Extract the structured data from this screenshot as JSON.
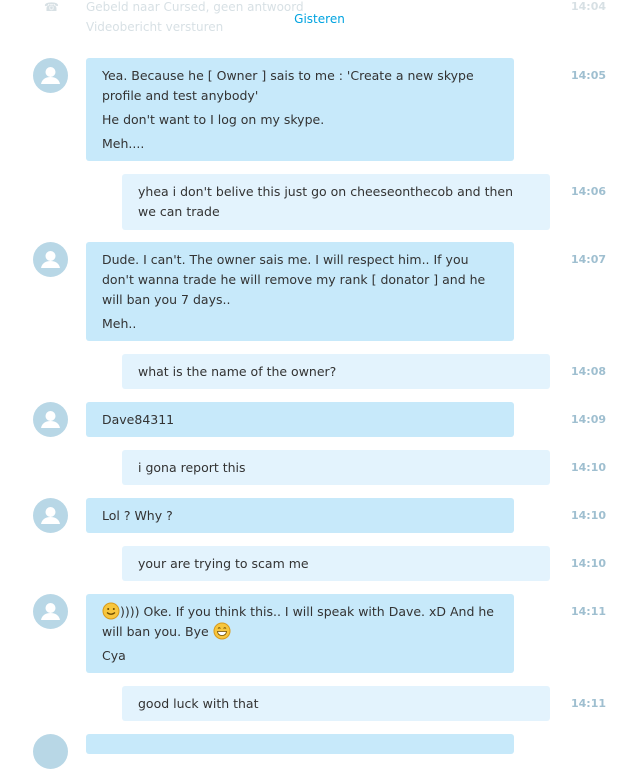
{
  "top_fade": {
    "call_line": "Gebeld naar Cursed, geen antwoord",
    "video_line": "Videobericht versturen",
    "time": "14:04"
  },
  "day_label": "Gisteren",
  "messages": [
    {
      "dir": "in",
      "time": "14:05",
      "lines": [
        "Yea. Because he [ Owner ] sais to me : 'Create a new skype profile and test anybody'",
        "He don't want to I log on my skype.",
        "Meh...."
      ]
    },
    {
      "dir": "out",
      "time": "14:06",
      "lines": [
        "yhea i don't belive this just go on cheeseonthecob and then we can trade"
      ]
    },
    {
      "dir": "in",
      "time": "14:07",
      "lines": [
        "Dude. I can't. The owner sais me. I will respect him.. If you don't wanna trade he will remove my rank [ donator ] and he will ban you 7 days..",
        "Meh.."
      ]
    },
    {
      "dir": "out",
      "time": "14:08",
      "lines": [
        "what is the name of the owner?"
      ]
    },
    {
      "dir": "in",
      "time": "14:09",
      "lines": [
        "Dave84311"
      ]
    },
    {
      "dir": "out",
      "time": "14:10",
      "lines": [
        "i gona report this"
      ]
    },
    {
      "dir": "in",
      "time": "14:10",
      "lines": [
        "Lol ? Why ?"
      ]
    },
    {
      "dir": "out",
      "time": "14:10",
      "lines": [
        "your are trying to scam me"
      ]
    },
    {
      "dir": "in",
      "time": "14:11",
      "emoji_text_a": ")))) Oke. If you think this.. I will speak with Dave. xD And he will ban you. Bye",
      "lines": [
        "Cya"
      ]
    },
    {
      "dir": "out",
      "time": "14:11",
      "lines": [
        "good luck with that"
      ]
    }
  ],
  "icons": {
    "avatar": "default-user-avatar-icon",
    "emoji": "smile-emoji-icon",
    "call": "phone-icon"
  },
  "colors": {
    "incoming_bubble": "#c7e9fa",
    "outgoing_bubble": "#e3f3fd",
    "avatar": "#b8d7e6",
    "accent": "#00a3e0",
    "timestamp": "#9fbfd0"
  }
}
